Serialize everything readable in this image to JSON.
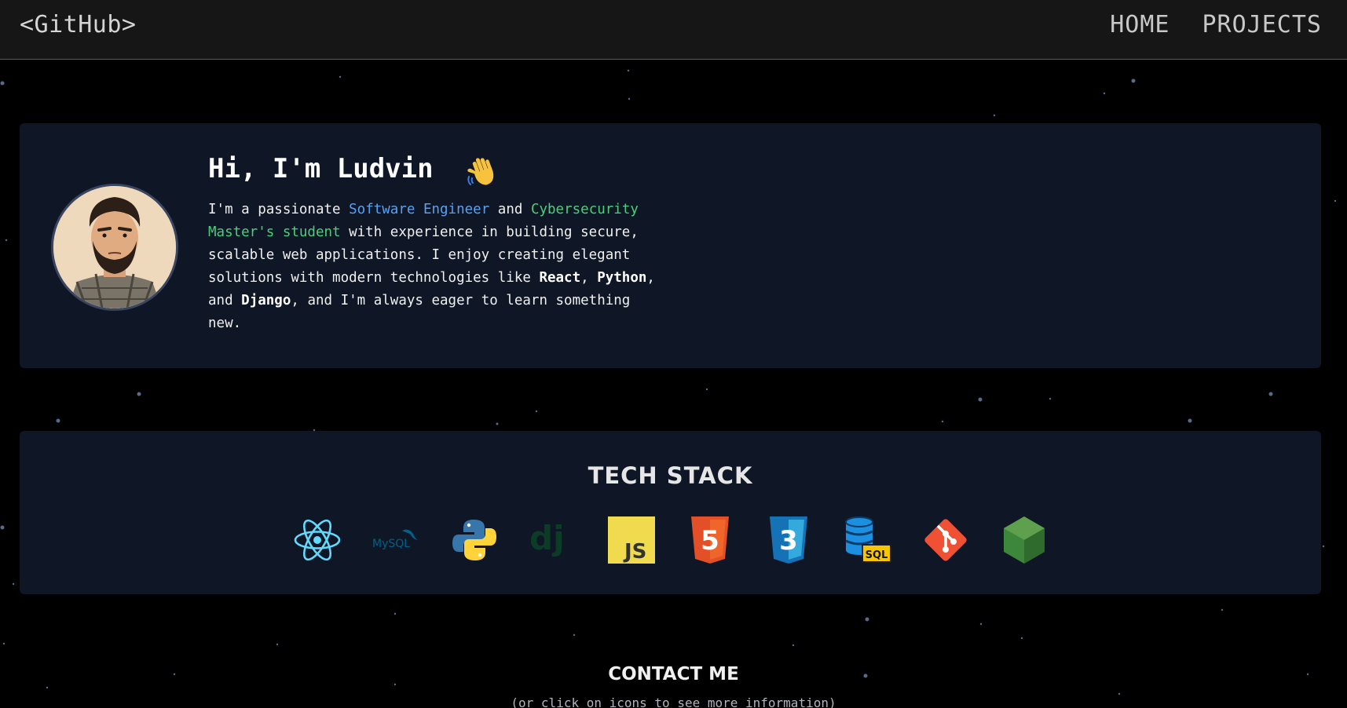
{
  "nav": {
    "brand": "<GitHub>",
    "links": [
      "HOME",
      "PROJECTS"
    ]
  },
  "intro": {
    "headline": "Hi, I'm Ludvin",
    "bio": {
      "p1": "I'm a passionate ",
      "role1": "Software Engineer",
      "p2": " and ",
      "role2": "Cybersecurity Master's student",
      "p3": " with experience in building secure, scalable web applications. I enjoy creating elegant solutions with modern technologies like ",
      "tech1": "React",
      "p4": ", ",
      "tech2": "Python",
      "p5": ", and ",
      "tech3": "Django",
      "p6": ", and I'm always eager to learn something new."
    }
  },
  "tech_stack": {
    "title": "TECH STACK",
    "icons": [
      "react-icon",
      "mysql-icon",
      "python-icon",
      "django-icon",
      "javascript-icon",
      "html5-icon",
      "css3-icon",
      "sql-database-icon",
      "git-icon",
      "nodejs-icon"
    ],
    "mysql_text": "MySQL",
    "django_text": "dj",
    "js_text": "JS",
    "html_text": "5",
    "css_text": "3",
    "sql_text": "SQL"
  },
  "contact": {
    "title": "CONTACT ME",
    "subtitle": "(or click on icons to see more information)"
  },
  "colors": {
    "background": "#000000",
    "navbar": "#161616",
    "card": "#0f1626",
    "accent_blue": "#5aa0f0",
    "accent_green": "#4ccf78",
    "react": "#61dafb",
    "html5": "#e34f26",
    "css3": "#1572b6",
    "javascript": "#f0db4f",
    "git": "#f05033",
    "node": "#3c873a",
    "django": "#0c3c26"
  }
}
